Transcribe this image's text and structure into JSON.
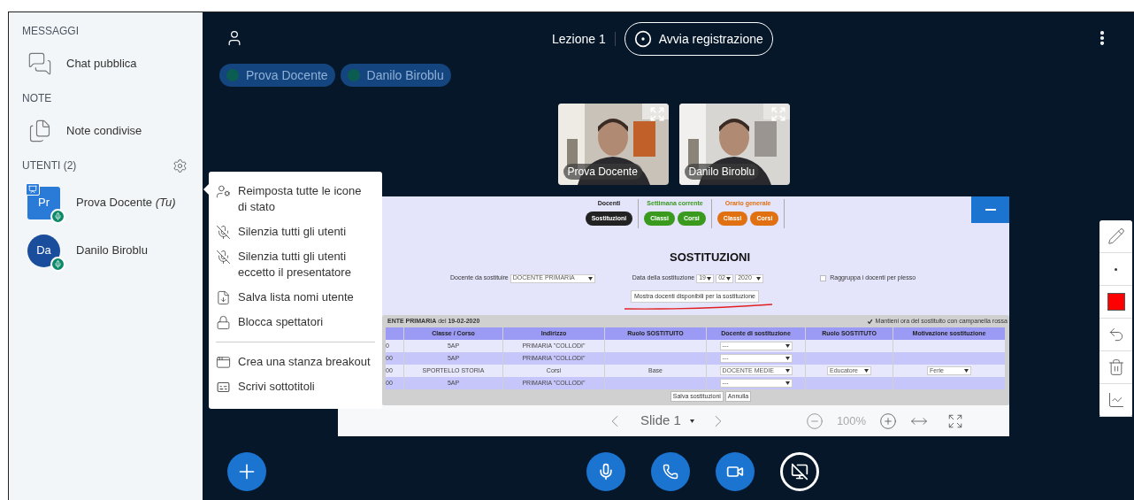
{
  "sidebar": {
    "sections": [
      {
        "title": "MESSAGGI",
        "items": [
          {
            "kind": "chat",
            "label": "Chat pubblica"
          }
        ]
      },
      {
        "title": "NOTE",
        "items": [
          {
            "kind": "notes",
            "label": "Note condivise"
          }
        ]
      }
    ],
    "users_title": "UTENTI (2)",
    "users": [
      {
        "initials": "Pr",
        "name": "Prova Docente",
        "suffix": "(Tu)",
        "moderator": true,
        "presenter": true
      },
      {
        "initials": "Da",
        "name": "Danilo Biroblu",
        "moderator": false,
        "presenter": false
      }
    ]
  },
  "menu": [
    {
      "kind": "status",
      "label": "Reimposta tutte le icone di stato"
    },
    {
      "kind": "mute",
      "label": "Silenzia tutti gli utenti"
    },
    {
      "kind": "mute",
      "label": "Silenzia tutti gli utenti eccetto il presentatore"
    },
    {
      "kind": "save",
      "label": "Salva lista nomi utente"
    },
    {
      "kind": "lock",
      "label": "Blocca spettatori"
    },
    {
      "kind": "divider"
    },
    {
      "kind": "breakout",
      "label": "Crea una stanza breakout"
    },
    {
      "kind": "captions",
      "label": "Scrivi sottotitoli"
    }
  ],
  "header": {
    "title": "Lezione 1",
    "record": "Avvia registrazione"
  },
  "talkers": [
    {
      "name": "Prova Docente"
    },
    {
      "name": "Danilo Biroblu"
    }
  ],
  "videos": [
    {
      "name": "Prova Docente"
    },
    {
      "name": "Danilo Biroblu"
    }
  ],
  "slide": {
    "nav_groups": [
      {
        "title": "Docenti",
        "color": "#222222",
        "buttons": [
          "Sostituzioni"
        ]
      },
      {
        "title": "Settimana corrente",
        "color": "#3a9a1e",
        "buttons": [
          "Classi",
          "Corsi"
        ]
      },
      {
        "title": "Orario generale",
        "color": "#e07010",
        "buttons": [
          "Classi",
          "Corsi"
        ]
      }
    ],
    "heading": "SOSTITUZIONI",
    "teacher_label": "Docente da sostituire",
    "teacher_value": "DOCENTE PRIMARIA",
    "date_label": "Data della sostituzione",
    "date_values": [
      "19",
      "02",
      "2020"
    ],
    "group_option": {
      "label": "Raggruppa i docenti per plesso",
      "checked": false
    },
    "show_button": "Mostra docenti disponibili per la sostituzione",
    "caption": "**ENTE PRIMARIA** del **19-02-2020**",
    "keep_option": {
      "label": "Mantieni ora del sostituito con campanella rossa",
      "checked": true
    },
    "columns": [
      "Classe / Corso",
      "Indirizzo",
      "Ruolo SOSTITUITO",
      "Docente di sostituzione",
      "Ruolo SOSTITUTO",
      "Motivazione sostituzione"
    ],
    "rows": [
      {
        "column_1": "0",
        "classe": "5AP",
        "indirizzo": "PRIMARIA \"COLLODI\"",
        "docente": "---"
      },
      {
        "column_1": "00",
        "classe": "5AP",
        "indirizzo": "PRIMARIA \"COLLODI\"",
        "docente": "---"
      },
      {
        "column_1": "00",
        "classe": "SPORTELLO STORIA",
        "indirizzo": "Corsi",
        "ruolo_sostituito": "Base",
        "docente": "DOCENTE MEDIE",
        "ruolo_sostituto": "Educatore",
        "motivazione": "Ferie"
      },
      {
        "column_1": "00",
        "classe": "5AP",
        "indirizzo": "PRIMARIA \"COLLODI\"",
        "docente": "---"
      }
    ],
    "actions": [
      "Salva sostituzioni",
      "Annulla"
    ]
  },
  "slide_toolbar": {
    "label": "Slide 1",
    "zoom": "100%"
  },
  "tools": [
    {
      "kind": "pencil"
    },
    {
      "kind": "size"
    },
    {
      "kind": "color",
      "color": "#ff0000"
    },
    {
      "kind": "undo"
    },
    {
      "kind": "clear"
    },
    {
      "kind": "chart"
    }
  ],
  "actions": [
    {
      "kind": "plus"
    },
    {
      "kind": "mic"
    },
    {
      "kind": "phone"
    },
    {
      "kind": "video"
    },
    {
      "kind": "screen"
    }
  ]
}
